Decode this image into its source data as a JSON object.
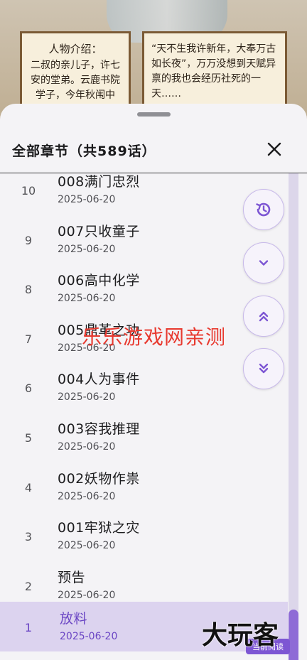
{
  "background": {
    "left_panel": {
      "title": "人物介绍：",
      "body": "二叔的亲儿子，许七安的堂弟。云鹿书院学子，今年秋闱中举。"
    },
    "right_panel": {
      "body": "“天不生我许新年，大奉万古如长夜”，万万没想到天赋异禀的我也会经历社死的一天……"
    }
  },
  "sheet": {
    "title": "全部章节（共589话）",
    "close_icon": "close-icon"
  },
  "chapters": [
    {
      "num": "10",
      "name": "008满门忠烈",
      "date": "2025-06-20"
    },
    {
      "num": "9",
      "name": "007只收童子",
      "date": "2025-06-20"
    },
    {
      "num": "8",
      "name": "006高中化学",
      "date": "2025-06-20"
    },
    {
      "num": "7",
      "name": "005鼎革之功",
      "date": "2025-06-20"
    },
    {
      "num": "6",
      "name": "004人为事件",
      "date": "2025-06-20"
    },
    {
      "num": "5",
      "name": "003容我推理",
      "date": "2025-06-20"
    },
    {
      "num": "4",
      "name": "002妖物作祟",
      "date": "2025-06-20"
    },
    {
      "num": "3",
      "name": "001牢狱之灾",
      "date": "2025-06-20"
    },
    {
      "num": "2",
      "name": "预告",
      "date": "2025-06-20"
    },
    {
      "num": "1",
      "name": "放料",
      "date": "2025-06-20"
    }
  ],
  "active_index": 9,
  "current_tag": "当前阅读",
  "fabs": [
    "history-icon",
    "chevron-down-icon",
    "double-chevron-up-icon",
    "double-chevron-down-icon"
  ],
  "scroll_position": 1.0,
  "watermarks": {
    "red": "乐乐游戏网亲测",
    "corner": "大玩客"
  },
  "colors": {
    "accent": "#7d56d3",
    "active_row": "#dcd3ef",
    "watermark_red": "#e8392f"
  }
}
